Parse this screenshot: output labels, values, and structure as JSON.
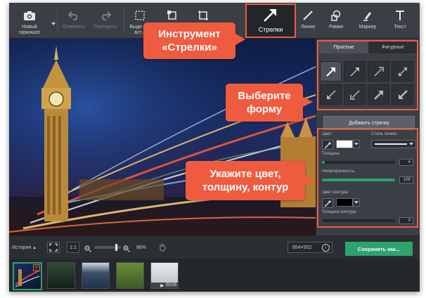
{
  "toolbar": {
    "items": [
      {
        "label": "Новый скриншот",
        "icon": "camera-icon"
      },
      {
        "label": "Отменить",
        "icon": "undo-icon"
      },
      {
        "label": "Повторить",
        "icon": "redo-icon"
      },
      {
        "label": "Выде... и вст...",
        "icon": "select-icon"
      },
      {
        "label": "",
        "icon": "crop-icon"
      },
      {
        "label": "",
        "icon": "resize-icon"
      },
      {
        "label": "Стрелки",
        "icon": "arrow-icon"
      },
      {
        "label": "Линии",
        "icon": "line-icon"
      },
      {
        "label": "Рамки",
        "icon": "shapes-icon"
      },
      {
        "label": "Маркер",
        "icon": "marker-icon"
      },
      {
        "label": "Текст",
        "icon": "text-icon"
      }
    ]
  },
  "panel": {
    "tabs": [
      "Простые",
      "Фигурные"
    ],
    "add_button": "Добавить стрелку",
    "color_label": "Цвет:",
    "line_style_label": "Стиль линии:",
    "thickness_label": "Толщина",
    "thickness_value": "4",
    "opacity_label": "Непрозрачность:",
    "opacity_value": "100",
    "outline_color_label": "Цвет контура:",
    "outline_thickness_label": "Толщина контура:",
    "outline_thickness_value": "0",
    "colors": {
      "fill": "#ffffff",
      "outline": "#000000"
    },
    "levels": {
      "thickness": 0.04,
      "opacity": 1.0,
      "outline_thickness": 0.0
    }
  },
  "bottom": {
    "history_label": "История",
    "fit_icon": "fit-screen-icon",
    "ratio_label": "1:1",
    "zoom_value": "86%",
    "zoom_level": 0.86,
    "hand_icon": "hand-icon",
    "size_value": "854×552",
    "info_icon": "info-icon",
    "save_label": "Сохранить как..."
  },
  "thumbs": {
    "count": 5,
    "duration": "00:03"
  },
  "callouts": {
    "tool": "Инструмент «Стрелки»",
    "tool_line1": "Инструмент",
    "tool_line2": "«Стрелки»",
    "shape_line1": "Выберите",
    "shape_line2": "форму",
    "props_line1": "Укажите цвет,",
    "props_line2": "толщину, контур"
  },
  "accent": "#ef5b3f",
  "save_color": "#2ea36c"
}
